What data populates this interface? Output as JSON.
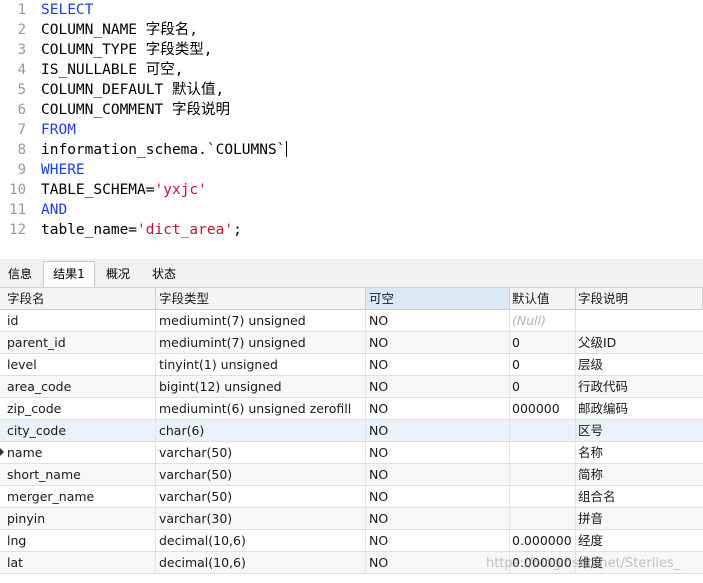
{
  "editor": {
    "lines": [
      {
        "no": "1",
        "segments": [
          {
            "t": "SELECT",
            "k": "kw"
          }
        ]
      },
      {
        "no": "2",
        "segments": [
          {
            "t": "COLUMN_NAME 字段名,",
            "k": ""
          }
        ]
      },
      {
        "no": "3",
        "segments": [
          {
            "t": "COLUMN_TYPE 字段类型,",
            "k": ""
          }
        ]
      },
      {
        "no": "4",
        "segments": [
          {
            "t": "IS_NULLABLE 可空,",
            "k": ""
          }
        ]
      },
      {
        "no": "5",
        "segments": [
          {
            "t": "COLUMN_DEFAULT 默认值,",
            "k": ""
          }
        ]
      },
      {
        "no": "6",
        "segments": [
          {
            "t": "COLUMN_COMMENT 字段说明",
            "k": ""
          }
        ]
      },
      {
        "no": "7",
        "segments": [
          {
            "t": "FROM",
            "k": "kw"
          }
        ]
      },
      {
        "no": "8",
        "segments": [
          {
            "t": "information_schema.`COLUMNS`",
            "k": ""
          }
        ],
        "caret": true
      },
      {
        "no": "9",
        "segments": [
          {
            "t": "WHERE",
            "k": "kw"
          }
        ]
      },
      {
        "no": "10",
        "segments": [
          {
            "t": "TABLE_SCHEMA=",
            "k": ""
          },
          {
            "t": "'yxjc'",
            "k": "str"
          }
        ]
      },
      {
        "no": "11",
        "segments": [
          {
            "t": "AND",
            "k": "kw"
          }
        ]
      },
      {
        "no": "12",
        "segments": [
          {
            "t": "table_name=",
            "k": ""
          },
          {
            "t": "'dict_area'",
            "k": "str"
          },
          {
            "t": ";",
            "k": ""
          }
        ]
      }
    ]
  },
  "tabs": [
    {
      "label": "信息",
      "active": false
    },
    {
      "label": "结果1",
      "active": true
    },
    {
      "label": "概况",
      "active": false
    },
    {
      "label": "状态",
      "active": false
    }
  ],
  "table": {
    "columns": [
      "字段名",
      "字段类型",
      "可空",
      "默认值",
      "字段说明"
    ],
    "rows": [
      [
        "id",
        "mediumint(7) unsigned",
        "NO",
        "(Null)",
        ""
      ],
      [
        "parent_id",
        "mediumint(7) unsigned",
        "NO",
        "0",
        "父级ID"
      ],
      [
        "level",
        "tinyint(1) unsigned",
        "NO",
        "0",
        "层级"
      ],
      [
        "area_code",
        "bigint(12) unsigned",
        "NO",
        "0",
        "行政代码"
      ],
      [
        "zip_code",
        "mediumint(6) unsigned zerofill",
        "NO",
        "000000",
        "邮政编码"
      ],
      [
        "city_code",
        "char(6)",
        "NO",
        "",
        "区号"
      ],
      [
        "name",
        "varchar(50)",
        "NO",
        "",
        "名称"
      ],
      [
        "short_name",
        "varchar(50)",
        "NO",
        "",
        "简称"
      ],
      [
        "merger_name",
        "varchar(50)",
        "NO",
        "",
        "组合名"
      ],
      [
        "pinyin",
        "varchar(30)",
        "NO",
        "",
        "拼音"
      ],
      [
        "lng",
        "decimal(10,6)",
        "NO",
        "0.000000",
        "经度"
      ],
      [
        "lat",
        "decimal(10,6)",
        "NO",
        "0.000000",
        "维度"
      ]
    ]
  },
  "watermark": "https://blog.csdn.net/Sterlies_"
}
